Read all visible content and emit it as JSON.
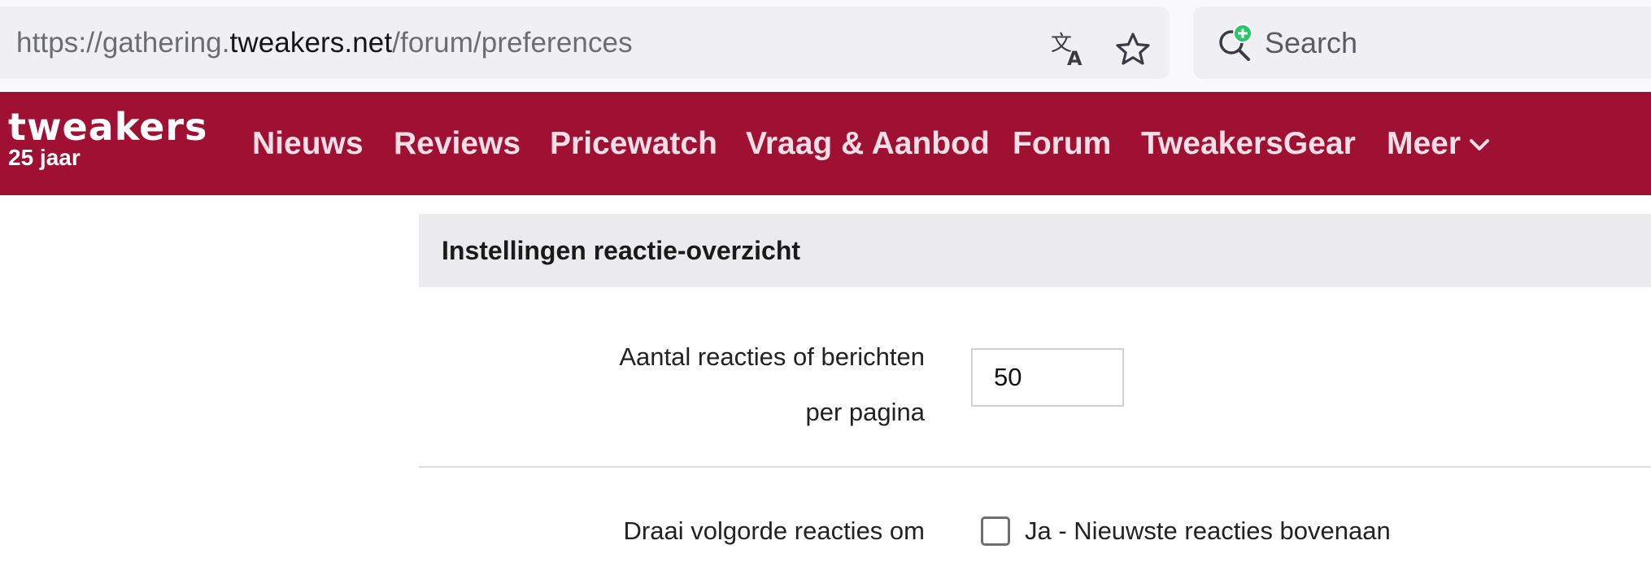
{
  "browser": {
    "url_prefix": "https://gathering.",
    "url_host": "tweakers.net",
    "url_path": "/forum/preferences",
    "search_placeholder": "Search",
    "icons": [
      "translate-icon",
      "bookmark-star-icon",
      "search-add-engine-icon"
    ]
  },
  "site": {
    "logo_word": "tweakers",
    "logo_sub": "25 jaar",
    "brand_color": "#a01033",
    "nav": [
      {
        "label": "Nieuws"
      },
      {
        "label": "Reviews"
      },
      {
        "label": "Pricewatch"
      },
      {
        "label": "Vraag & Aanbod"
      },
      {
        "label": "Forum"
      },
      {
        "label": "TweakersGear"
      },
      {
        "label": "Meer"
      }
    ]
  },
  "settings": {
    "section_title": "Instellingen reactie-overzicht",
    "posts_per_page": {
      "label": "Aantal reacties of berichten per pagina",
      "value": "50"
    },
    "reverse_order": {
      "label": "Draai volgorde reacties om",
      "option_label": "Ja - Nieuwste reacties bovenaan",
      "checked": false
    }
  }
}
